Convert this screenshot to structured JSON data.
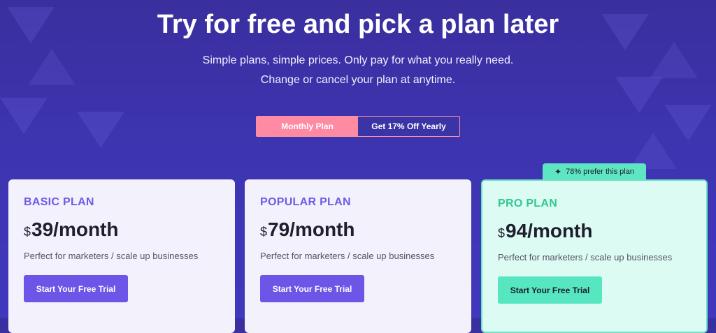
{
  "hero": {
    "title": "Try for free and pick a plan later",
    "subtitle_line1": "Simple plans, simple prices. Only pay for what you really need.",
    "subtitle_line2": "Change or cancel your plan at anytime."
  },
  "toggle": {
    "monthly_label": "Monthly Plan",
    "yearly_label": "Get 17% Off Yearly",
    "active": "monthly"
  },
  "badge": {
    "icon": "sparkle-icon",
    "text": "78% prefer this plan"
  },
  "plans": [
    {
      "name": "BASIC PLAN",
      "currency": "$",
      "amount": "39",
      "period": "/month",
      "description": "Perfect for marketers / scale up businesses",
      "cta": "Start Your Free Trial"
    },
    {
      "name": "POPULAR PLAN",
      "currency": "$",
      "amount": "79",
      "period": "/month",
      "description": "Perfect for marketers / scale up businesses",
      "cta": "Start Your Free Trial"
    },
    {
      "name": "PRO PLAN",
      "currency": "$",
      "amount": "94",
      "period": "/month",
      "description": "Perfect for marketers / scale up businesses",
      "cta": "Start Your Free Trial"
    }
  ],
  "colors": {
    "background": "#3d34b0",
    "accent_purple": "#6d55e8",
    "accent_pink": "#ff8aa4",
    "accent_green": "#56e6c0"
  }
}
